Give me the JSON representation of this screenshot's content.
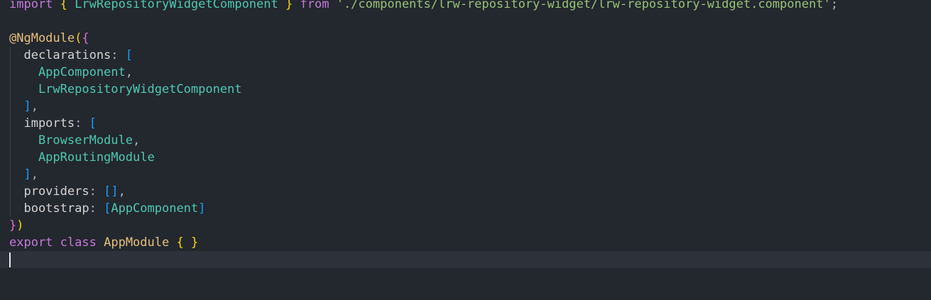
{
  "editor": {
    "language": "typescript",
    "lines": [
      {
        "tokens": [
          {
            "text": "import",
            "kind": "kw"
          },
          {
            "text": " ",
            "kind": "punc"
          },
          {
            "text": "{",
            "kind": "brace"
          },
          {
            "text": " ",
            "kind": "punc"
          },
          {
            "text": "LrwRepositoryWidgetComponent",
            "kind": "cls"
          },
          {
            "text": " ",
            "kind": "punc"
          },
          {
            "text": "}",
            "kind": "brace"
          },
          {
            "text": " ",
            "kind": "punc"
          },
          {
            "text": "from",
            "kind": "kw"
          },
          {
            "text": " ",
            "kind": "punc"
          },
          {
            "text": "'./components/lrw-repository-widget/lrw-repository-widget.component'",
            "kind": "str"
          },
          {
            "text": ";",
            "kind": "punc"
          }
        ]
      },
      {
        "tokens": []
      },
      {
        "tokens": [
          {
            "text": "@NgModule",
            "kind": "deco"
          },
          {
            "text": "(",
            "kind": "brace"
          },
          {
            "text": "{",
            "kind": "brace2"
          }
        ]
      },
      {
        "tokens": [
          {
            "text": "  declarations",
            "kind": "prop"
          },
          {
            "text": ": ",
            "kind": "punc"
          },
          {
            "text": "[",
            "kind": "brace3"
          }
        ]
      },
      {
        "tokens": [
          {
            "text": "    AppComponent",
            "kind": "cls"
          },
          {
            "text": ",",
            "kind": "punc"
          }
        ]
      },
      {
        "tokens": [
          {
            "text": "    LrwRepositoryWidgetComponent",
            "kind": "cls"
          }
        ]
      },
      {
        "tokens": [
          {
            "text": "  ]",
            "kind": "brace3"
          },
          {
            "text": ",",
            "kind": "punc"
          }
        ]
      },
      {
        "tokens": [
          {
            "text": "  imports",
            "kind": "prop"
          },
          {
            "text": ": ",
            "kind": "punc"
          },
          {
            "text": "[",
            "kind": "brace3"
          }
        ]
      },
      {
        "tokens": [
          {
            "text": "    BrowserModule",
            "kind": "cls"
          },
          {
            "text": ",",
            "kind": "punc"
          }
        ]
      },
      {
        "tokens": [
          {
            "text": "    AppRoutingModule",
            "kind": "cls"
          }
        ]
      },
      {
        "tokens": [
          {
            "text": "  ]",
            "kind": "brace3"
          },
          {
            "text": ",",
            "kind": "punc"
          }
        ]
      },
      {
        "tokens": [
          {
            "text": "  providers",
            "kind": "prop"
          },
          {
            "text": ": ",
            "kind": "punc"
          },
          {
            "text": "[]",
            "kind": "brace3"
          },
          {
            "text": ",",
            "kind": "punc"
          }
        ]
      },
      {
        "tokens": [
          {
            "text": "  bootstrap",
            "kind": "prop"
          },
          {
            "text": ": ",
            "kind": "punc"
          },
          {
            "text": "[",
            "kind": "brace3"
          },
          {
            "text": "AppComponent",
            "kind": "cls"
          },
          {
            "text": "]",
            "kind": "brace3"
          }
        ]
      },
      {
        "tokens": [
          {
            "text": "}",
            "kind": "brace2"
          },
          {
            "text": ")",
            "kind": "brace"
          }
        ]
      },
      {
        "tokens": [
          {
            "text": "export",
            "kind": "kw"
          },
          {
            "text": " ",
            "kind": "punc"
          },
          {
            "text": "class",
            "kind": "kw"
          },
          {
            "text": " ",
            "kind": "punc"
          },
          {
            "text": "AppModule",
            "kind": "ident"
          },
          {
            "text": " ",
            "kind": "punc"
          },
          {
            "text": "{",
            "kind": "brace"
          },
          {
            "text": " ",
            "kind": "punc"
          },
          {
            "text": "}",
            "kind": "brace"
          }
        ]
      },
      {
        "tokens": []
      }
    ],
    "current_line": 15,
    "colors": {
      "background": "#23272e",
      "current_line": "#2c313a",
      "keyword": "#c678dd",
      "bracket_level_1": "#ffd700",
      "bracket_level_2": "#da70d6",
      "bracket_level_3": "#179fff",
      "class_name": "#4ec9b0",
      "string": "#98c379",
      "decorator": "#e5c07b"
    }
  }
}
